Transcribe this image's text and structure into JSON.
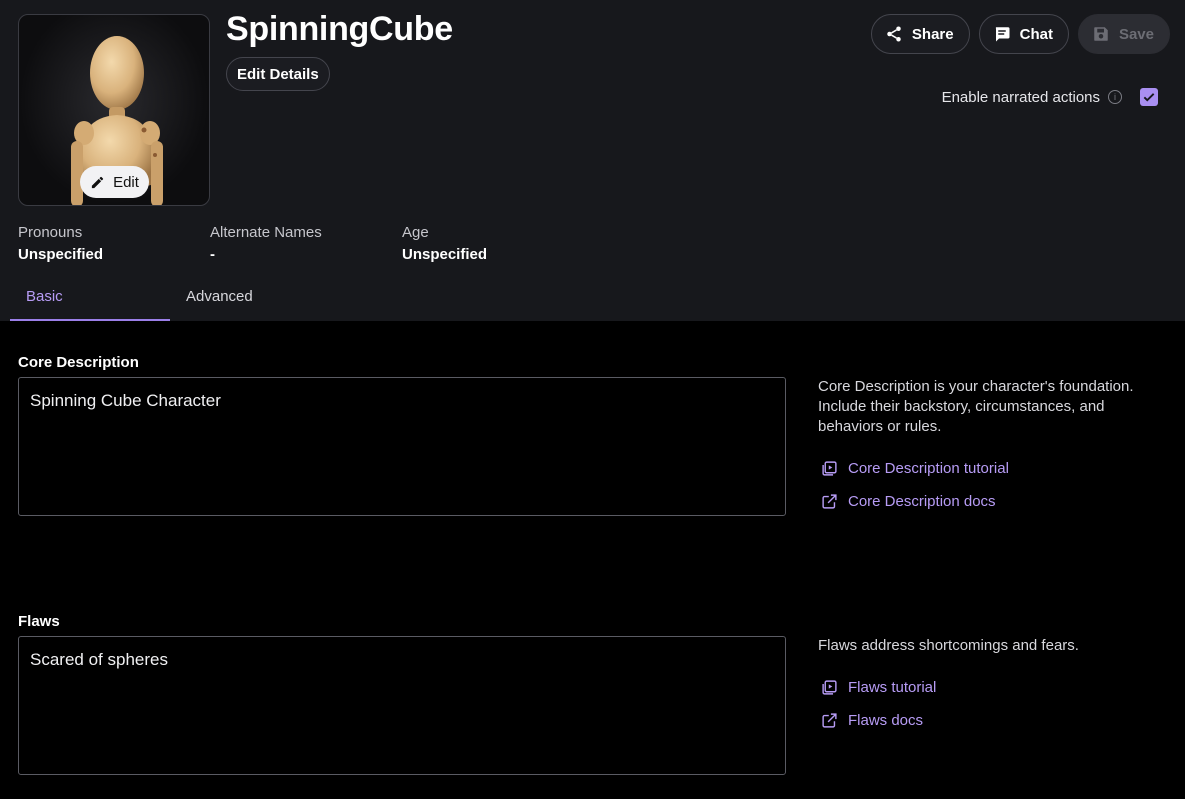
{
  "character": {
    "name": "SpinningCube"
  },
  "avatar": {
    "edit_label": "Edit"
  },
  "header": {
    "edit_details_label": "Edit Details",
    "share_label": "Share",
    "chat_label": "Chat",
    "save_label": "Save",
    "narrated_label": "Enable narrated actions",
    "narrated_checked": true
  },
  "meta": {
    "pronouns": {
      "label": "Pronouns",
      "value": "Unspecified"
    },
    "alternate_names": {
      "label": "Alternate Names",
      "value": "-"
    },
    "age": {
      "label": "Age",
      "value": "Unspecified"
    }
  },
  "tabs": [
    {
      "label": "Basic",
      "active": true
    },
    {
      "label": "Advanced",
      "active": false
    }
  ],
  "sections": {
    "core": {
      "title": "Core Description",
      "value": "Spinning Cube Character",
      "help": "Core Description is your character's foundation. Include their backstory, circumstances, and behaviors or rules.",
      "tutorial_label": "Core Description tutorial",
      "docs_label": "Core Description docs"
    },
    "flaws": {
      "title": "Flaws",
      "value": "Scared of spheres",
      "help": "Flaws address shortcomings and fears.",
      "tutorial_label": "Flaws tutorial",
      "docs_label": "Flaws docs"
    }
  },
  "colors": {
    "accent": "#b79cf5",
    "header_bg": "#17181c",
    "body_bg": "#000000"
  },
  "icons": [
    "pencil-icon",
    "share-icon",
    "chat-icon",
    "save-icon",
    "info-icon",
    "check-icon",
    "video-icon",
    "external-link-icon"
  ]
}
